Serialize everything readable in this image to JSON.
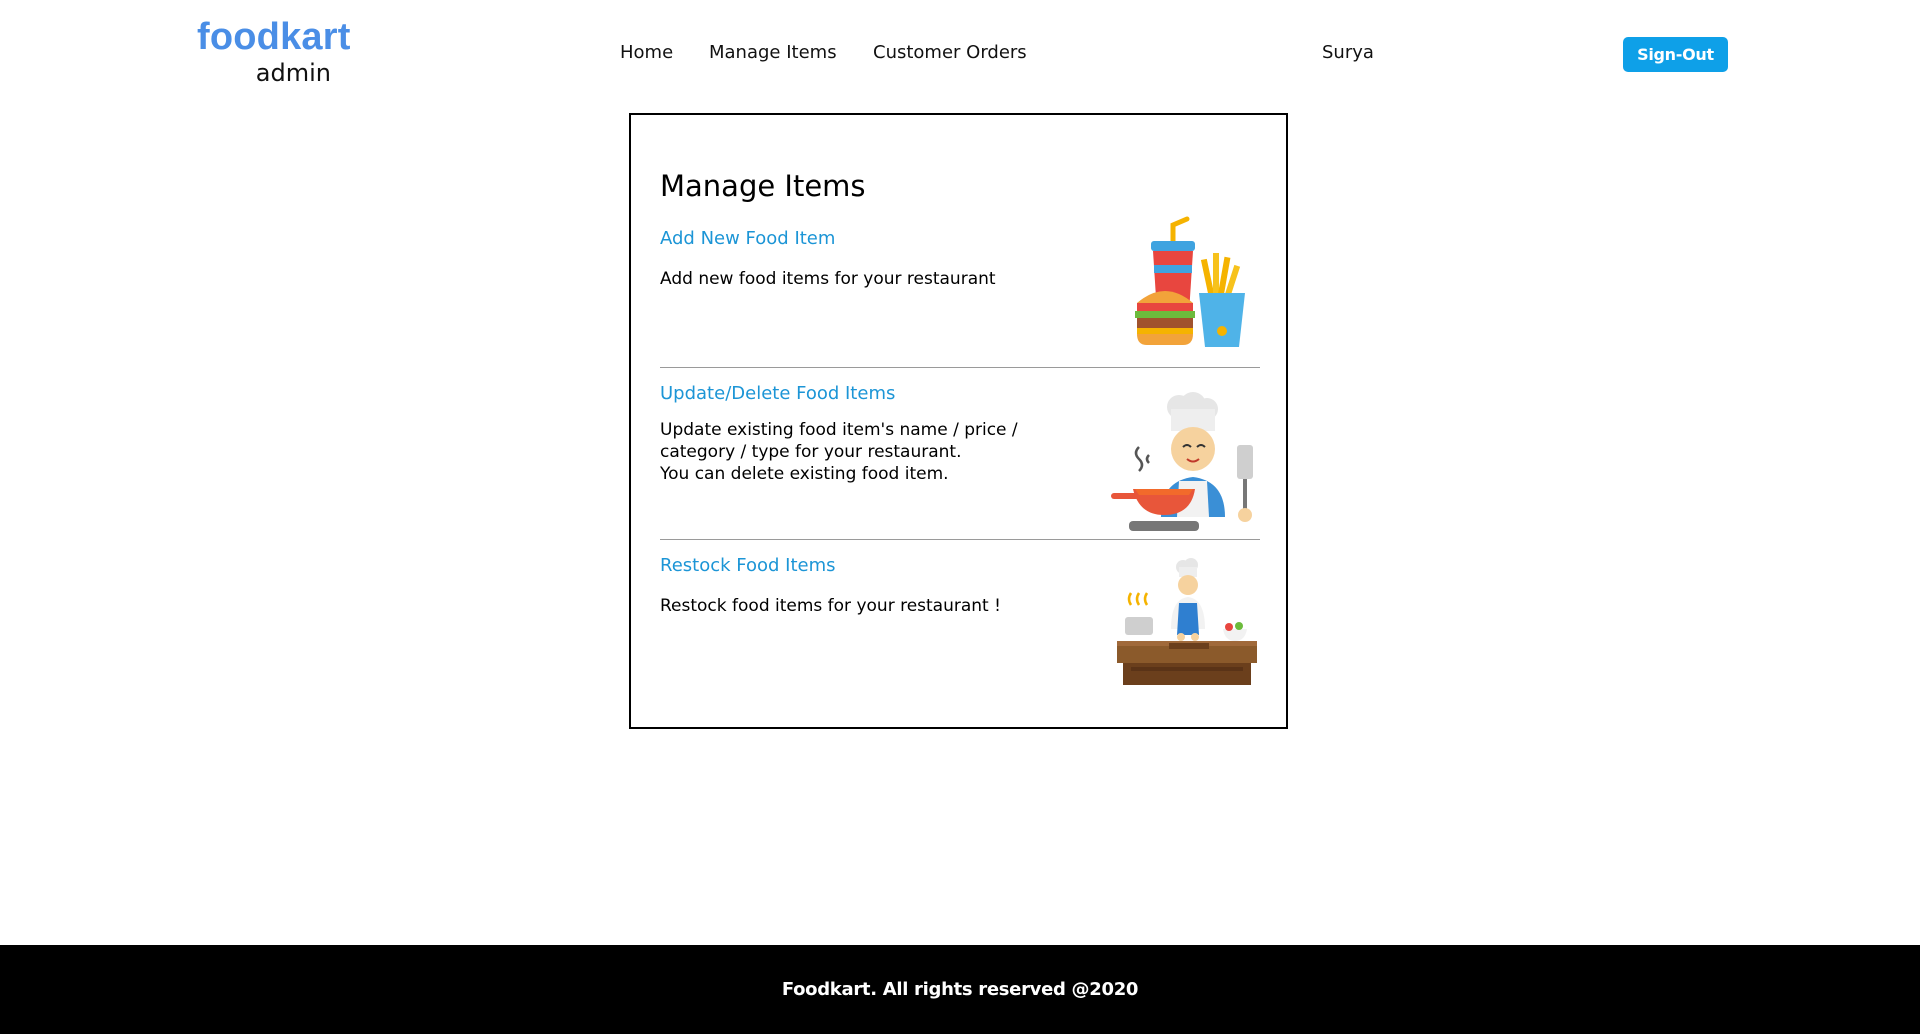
{
  "header": {
    "logo_text": "foodkart",
    "logo_sub": "admin",
    "nav": [
      "Home",
      "Manage Items",
      "Customer Orders"
    ],
    "username": "Surya",
    "signout_label": "Sign-Out"
  },
  "card": {
    "title": "Manage Items",
    "sections": [
      {
        "link": "Add New Food Item",
        "description": "Add new food items for your restaurant",
        "icon": "fast-food-icon"
      },
      {
        "link": "Update/Delete Food Items",
        "description": "Update existing food item's name / price /\ncategory / type for your restaurant.\nYou can delete existing food item.",
        "icon": "chef-cooking-icon"
      },
      {
        "link": "Restock Food Items",
        "description": "Restock food items for your restaurant !",
        "icon": "chef-kitchen-icon"
      }
    ]
  },
  "footer": {
    "text": "Foodkart. All rights reserved @2020"
  },
  "colors": {
    "brand": "#4a8ee6",
    "link": "#1c95d6",
    "button": "#0ea0e8",
    "footer_bg": "#000000"
  }
}
